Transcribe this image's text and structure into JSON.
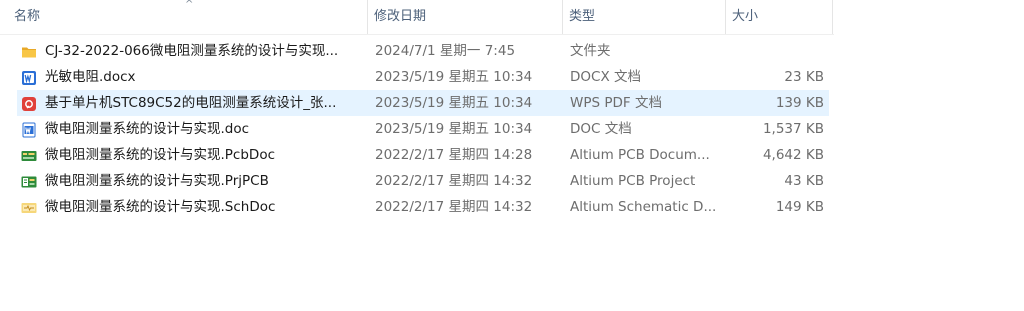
{
  "columns": {
    "name": "名称",
    "date": "修改日期",
    "type": "类型",
    "size": "大小",
    "sort_indicator": "^"
  },
  "files": [
    {
      "name": "CJ-32-2022-066微电阻测量系统的设计与实现...",
      "date": "2024/7/1 星期一 7:45",
      "type": "文件夹",
      "size": "",
      "icon": "folder-icon"
    },
    {
      "name": "光敏电阻.docx",
      "date": "2023/5/19 星期五 10:34",
      "type": "DOCX 文档",
      "size": "23 KB",
      "icon": "word-docx-icon"
    },
    {
      "name": "基于单片机STC89C52的电阻测量系统设计_张...",
      "date": "2023/5/19 星期五 10:34",
      "type": "WPS PDF 文档",
      "size": "139 KB",
      "icon": "wps-pdf-icon"
    },
    {
      "name": "微电阻测量系统的设计与实现.doc",
      "date": "2023/5/19 星期五 10:34",
      "type": "DOC 文档",
      "size": "1,537 KB",
      "icon": "word-doc-icon"
    },
    {
      "name": "微电阻测量系统的设计与实现.PcbDoc",
      "date": "2022/2/17 星期四 14:28",
      "type": "Altium PCB Docum...",
      "size": "4,642 KB",
      "icon": "altium-pcb-icon"
    },
    {
      "name": "微电阻测量系统的设计与实现.PrjPCB",
      "date": "2022/2/17 星期四 14:32",
      "type": "Altium PCB Project",
      "size": "43 KB",
      "icon": "altium-project-icon"
    },
    {
      "name": "微电阻测量系统的设计与实现.SchDoc",
      "date": "2022/2/17 星期四 14:32",
      "type": "Altium Schematic D...",
      "size": "149 KB",
      "icon": "altium-schematic-icon"
    }
  ],
  "selected_index": 2,
  "colors": {
    "header_text": "#4c607a",
    "selection": "#e5f3ff",
    "folder": "#f8c646",
    "word": "#2b6fd6",
    "pdf": "#e0413b",
    "altium_green": "#2e8b3a"
  }
}
